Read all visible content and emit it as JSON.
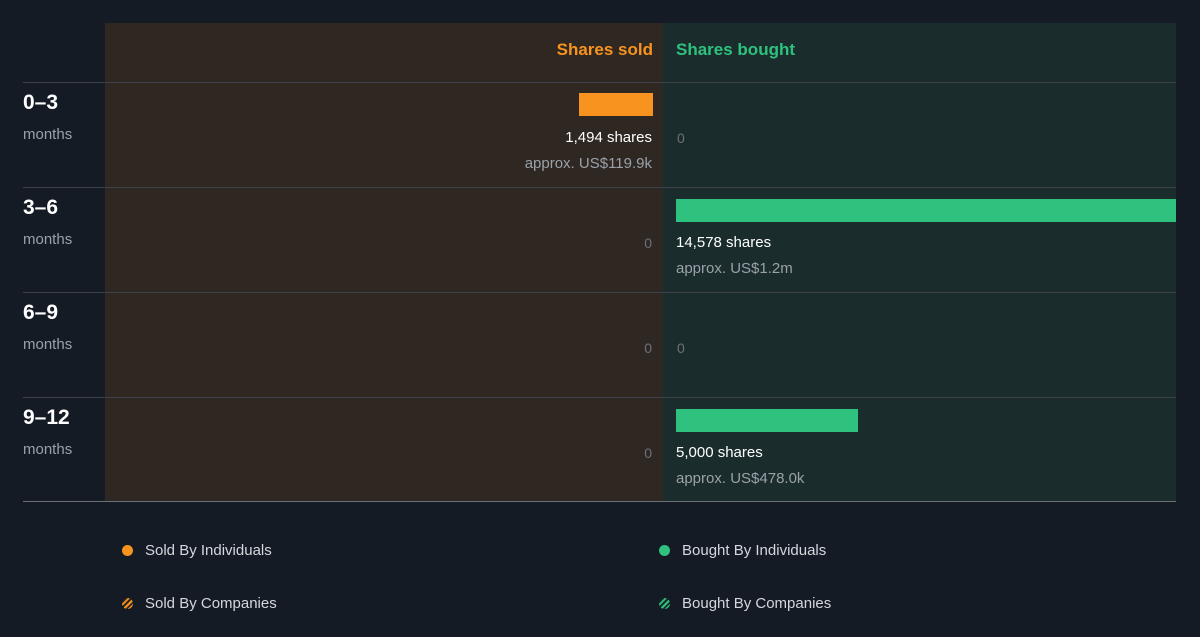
{
  "headers": {
    "sold": "Shares sold",
    "bought": "Shares bought"
  },
  "colors": {
    "sold": "#f7931e",
    "bought": "#2ec27e",
    "background": "#151b24"
  },
  "periods": [
    {
      "range": "0–3",
      "unit": "months",
      "sold": {
        "shares_label": "1,494 shares",
        "approx_label": "approx. US$119.9k"
      },
      "bought": {
        "zero_label": "0"
      }
    },
    {
      "range": "3–6",
      "unit": "months",
      "sold": {
        "zero_label": "0"
      },
      "bought": {
        "shares_label": "14,578 shares",
        "approx_label": "approx. US$1.2m"
      }
    },
    {
      "range": "6–9",
      "unit": "months",
      "sold": {
        "zero_label": "0"
      },
      "bought": {
        "zero_label": "0"
      }
    },
    {
      "range": "9–12",
      "unit": "months",
      "sold": {
        "zero_label": "0"
      },
      "bought": {
        "shares_label": "5,000 shares",
        "approx_label": "approx. US$478.0k"
      }
    }
  ],
  "legend": {
    "sold_individuals": "Sold By Individuals",
    "bought_individuals": "Bought By Individuals",
    "sold_companies": "Sold By Companies",
    "bought_companies": "Bought By Companies"
  },
  "chart_data": {
    "type": "bar",
    "categories": [
      "0–3",
      "3–6",
      "6–9",
      "9–12"
    ],
    "category_unit": "months",
    "series": [
      {
        "name": "Shares sold",
        "values": [
          1494,
          0,
          0,
          0
        ],
        "approx_usd": [
          "US$119.9k",
          null,
          null,
          null
        ]
      },
      {
        "name": "Shares bought",
        "values": [
          0,
          14578,
          0,
          5000
        ],
        "approx_usd": [
          null,
          "US$1.2m",
          null,
          "US$478.0k"
        ]
      }
    ],
    "legend": [
      "Sold By Individuals",
      "Bought By Individuals",
      "Sold By Companies",
      "Bought By Companies"
    ],
    "legend_position": "bottom",
    "xmax": 14578
  }
}
